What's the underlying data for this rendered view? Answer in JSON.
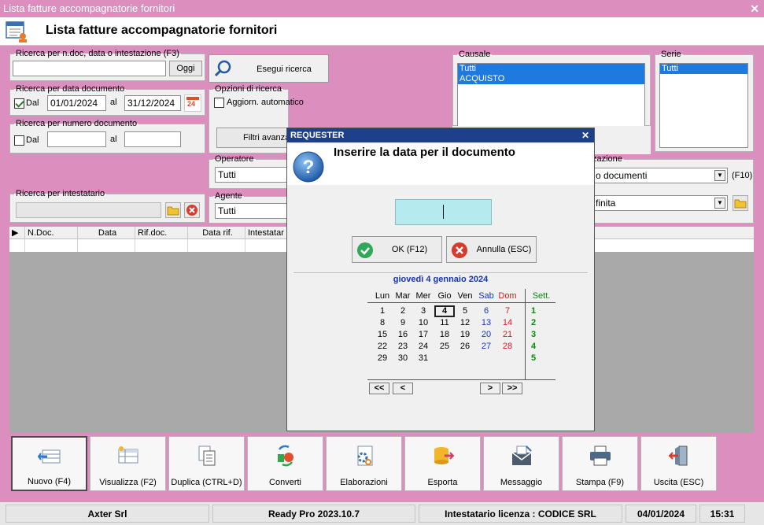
{
  "window": {
    "title": "Lista fatture accompagnatorie fornitori",
    "close_glyph": "✕"
  },
  "header": {
    "title": "Lista fatture accompagnatorie fornitori",
    "icon": "document-list-icon"
  },
  "search": {
    "text_group": "Ricerca per n.doc, data o intestazione (F3)",
    "text_value": "",
    "oggi": "Oggi",
    "date_group": "Ricerca per data documento",
    "date_dal_label": "Dal",
    "date_from": "01/01/2024",
    "date_al_label": "al",
    "date_to": "31/12/2024",
    "date_checked": true,
    "calendar_badge": "24",
    "num_group": "Ricerca per numero documento",
    "num_dal_label": "Dal",
    "num_from": "",
    "num_al_label": "al",
    "num_to": "",
    "num_checked": false,
    "holder_group": "Ricerca per intestatario",
    "holder_value": "",
    "exec_button": "Esegui ricerca"
  },
  "options": {
    "group": "Opzioni di ricerca",
    "auto_update": "Aggiorn. automatico",
    "auto_checked": false,
    "advanced_filters": "Filtri avanza",
    "operator_group": "Operatore",
    "operator_value": "Tutti",
    "agent_group": "Agente",
    "agent_value": "Tutti"
  },
  "causale": {
    "group": "Causale",
    "items": [
      "Tutti",
      "ACQUISTO"
    ]
  },
  "serie": {
    "group": "Serie",
    "items": [
      "Tutti"
    ]
  },
  "visual": {
    "group": "zazione",
    "combo1": "o documenti",
    "combo1_hint": "(F10)",
    "combo2": "finita"
  },
  "grid": {
    "columns": [
      "N.Doc.",
      "Data",
      "Rif.doc.",
      "Data rif.",
      "Intestatar"
    ]
  },
  "toolbar": [
    {
      "label": "Nuovo (F4)",
      "icon": "new-document-icon"
    },
    {
      "label": "Visualizza (F2)",
      "icon": "view-grid-icon"
    },
    {
      "label": "Duplica (CTRL+D)",
      "icon": "duplicate-icon"
    },
    {
      "label": "Converti",
      "icon": "convert-icon"
    },
    {
      "label": "Elaborazioni",
      "icon": "process-gear-icon"
    },
    {
      "label": "Esporta",
      "icon": "export-database-icon"
    },
    {
      "label": "Messaggio",
      "icon": "message-icon"
    },
    {
      "label": "Stampa (F9)",
      "icon": "printer-icon"
    },
    {
      "label": "Uscita (ESC)",
      "icon": "exit-door-icon"
    }
  ],
  "status": {
    "company": "Axter Srl",
    "version": "Ready Pro 2023.10.7",
    "license": "Intestatario licenza : CODICE SRL",
    "date": "04/01/2024",
    "time": "15:31"
  },
  "dialog": {
    "title": "REQUESTER",
    "close_glyph": "✕",
    "message": "Inserire la data per il documento",
    "input_value": "",
    "ok": "OK (F12)",
    "cancel": "Annulla (ESC)"
  },
  "calendar": {
    "title": "giovedì 4 gennaio 2024",
    "weekdays": [
      "Lun",
      "Mar",
      "Mer",
      "Gio",
      "Ven",
      "Sab",
      "Dom"
    ],
    "week_header": "Sett.",
    "weeks": [
      {
        "num": "1",
        "days": [
          "",
          "1",
          "2",
          "3",
          "4",
          "5",
          "6",
          "7"
        ]
      },
      {
        "num": "2",
        "days": [
          "",
          "8",
          "9",
          "10",
          "11",
          "12",
          "13",
          "14"
        ]
      },
      {
        "num": "3",
        "days": [
          "",
          "15",
          "16",
          "17",
          "18",
          "19",
          "20",
          "21"
        ]
      },
      {
        "num": "4",
        "days": [
          "",
          "22",
          "23",
          "24",
          "25",
          "26",
          "27",
          "28"
        ]
      },
      {
        "num": "5",
        "days": [
          "",
          "29",
          "30",
          "31",
          "",
          "",
          "",
          ""
        ]
      }
    ],
    "selected_day": "4",
    "nav": [
      "<<",
      "<",
      ">",
      ">>"
    ],
    "colors": {
      "title": "#1633b5",
      "saturday": "#1633b5",
      "sunday": "#d01c1c",
      "week": "#0a8a0a"
    }
  }
}
